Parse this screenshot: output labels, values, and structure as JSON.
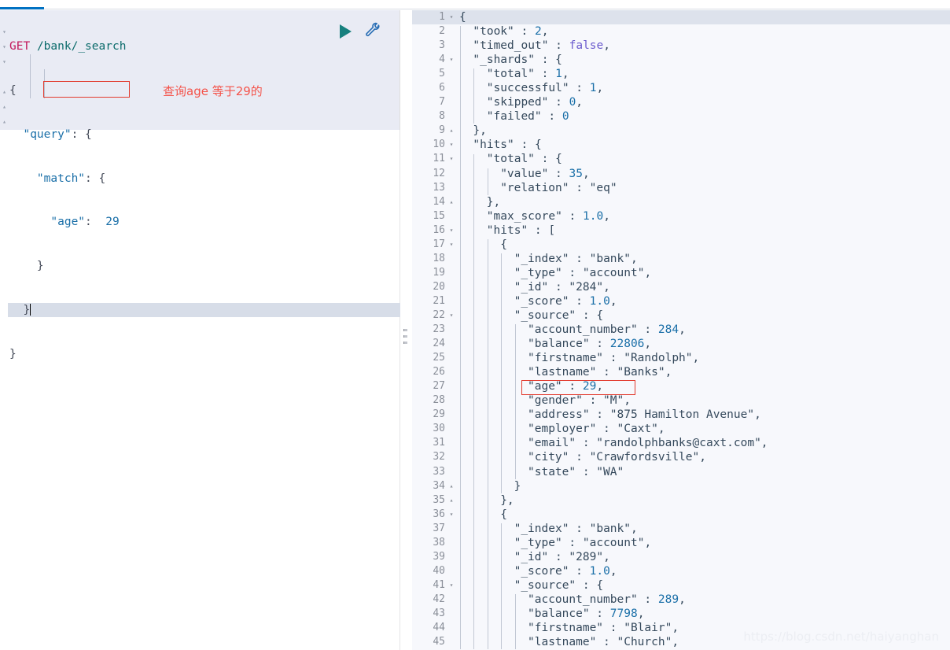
{
  "colors": {
    "accent": "#0071c2",
    "play": "#17807e",
    "wrench": "#2a6fb5",
    "annotation": "#f4534a",
    "redbox": "#e23b2e",
    "editor_bg": "#e9ebf4",
    "output_bg": "#f7f8fc",
    "active_line": "#d7dde8"
  },
  "toolbar": {
    "play_label": "play-icon",
    "wrench_label": "wrench-icon"
  },
  "request_editor": {
    "method": "GET",
    "path": "/bank/_search",
    "lines": [
      "GET /bank/_search",
      "{",
      "  \"query\": {",
      "    \"match\": {",
      "      \"age\": 29",
      "    }",
      "  }",
      "}"
    ],
    "tokens": {
      "l1_method": "GET",
      "l1_path": "/bank/_search",
      "l2": "{",
      "l3_key": "\"query\"",
      "l3_colon": ":",
      "l3_brace": "{",
      "l4_key": "\"match\"",
      "l4_colon": ":",
      "l4_brace": "{",
      "l5_key": "\"age\"",
      "l5_colon": ":",
      "l5_value": "29",
      "l6": "}",
      "l7": "}",
      "l8": "}"
    },
    "annotation": "查询age 等于29的",
    "highlight_field": "\"age\": 29"
  },
  "response": {
    "highlight_field": "\"age\" : 29,",
    "lines": [
      {
        "n": "1",
        "fold": "▾",
        "active": true,
        "indent": 0,
        "text": "{"
      },
      {
        "n": "2",
        "fold": "",
        "active": false,
        "indent": 1,
        "text": "\"took\" : 2,"
      },
      {
        "n": "3",
        "fold": "",
        "active": false,
        "indent": 1,
        "text": "\"timed_out\" : false,"
      },
      {
        "n": "4",
        "fold": "▾",
        "active": false,
        "indent": 1,
        "text": "\"_shards\" : {"
      },
      {
        "n": "5",
        "fold": "",
        "active": false,
        "indent": 2,
        "text": "\"total\" : 1,"
      },
      {
        "n": "6",
        "fold": "",
        "active": false,
        "indent": 2,
        "text": "\"successful\" : 1,"
      },
      {
        "n": "7",
        "fold": "",
        "active": false,
        "indent": 2,
        "text": "\"skipped\" : 0,"
      },
      {
        "n": "8",
        "fold": "",
        "active": false,
        "indent": 2,
        "text": "\"failed\" : 0"
      },
      {
        "n": "9",
        "fold": "▴",
        "active": false,
        "indent": 1,
        "text": "},"
      },
      {
        "n": "10",
        "fold": "▾",
        "active": false,
        "indent": 1,
        "text": "\"hits\" : {"
      },
      {
        "n": "11",
        "fold": "▾",
        "active": false,
        "indent": 2,
        "text": "\"total\" : {"
      },
      {
        "n": "12",
        "fold": "",
        "active": false,
        "indent": 3,
        "text": "\"value\" : 35,"
      },
      {
        "n": "13",
        "fold": "",
        "active": false,
        "indent": 3,
        "text": "\"relation\" : \"eq\""
      },
      {
        "n": "14",
        "fold": "▴",
        "active": false,
        "indent": 2,
        "text": "},"
      },
      {
        "n": "15",
        "fold": "",
        "active": false,
        "indent": 2,
        "text": "\"max_score\" : 1.0,"
      },
      {
        "n": "16",
        "fold": "▾",
        "active": false,
        "indent": 2,
        "text": "\"hits\" : ["
      },
      {
        "n": "17",
        "fold": "▾",
        "active": false,
        "indent": 3,
        "text": "{"
      },
      {
        "n": "18",
        "fold": "",
        "active": false,
        "indent": 4,
        "text": "\"_index\" : \"bank\","
      },
      {
        "n": "19",
        "fold": "",
        "active": false,
        "indent": 4,
        "text": "\"_type\" : \"account\","
      },
      {
        "n": "20",
        "fold": "",
        "active": false,
        "indent": 4,
        "text": "\"_id\" : \"284\","
      },
      {
        "n": "21",
        "fold": "",
        "active": false,
        "indent": 4,
        "text": "\"_score\" : 1.0,"
      },
      {
        "n": "22",
        "fold": "▾",
        "active": false,
        "indent": 4,
        "text": "\"_source\" : {"
      },
      {
        "n": "23",
        "fold": "",
        "active": false,
        "indent": 5,
        "text": "\"account_number\" : 284,"
      },
      {
        "n": "24",
        "fold": "",
        "active": false,
        "indent": 5,
        "text": "\"balance\" : 22806,"
      },
      {
        "n": "25",
        "fold": "",
        "active": false,
        "indent": 5,
        "text": "\"firstname\" : \"Randolph\","
      },
      {
        "n": "26",
        "fold": "",
        "active": false,
        "indent": 5,
        "text": "\"lastname\" : \"Banks\","
      },
      {
        "n": "27",
        "fold": "",
        "active": false,
        "indent": 5,
        "text": "\"age\" : 29,"
      },
      {
        "n": "28",
        "fold": "",
        "active": false,
        "indent": 5,
        "text": "\"gender\" : \"M\","
      },
      {
        "n": "29",
        "fold": "",
        "active": false,
        "indent": 5,
        "text": "\"address\" : \"875 Hamilton Avenue\","
      },
      {
        "n": "30",
        "fold": "",
        "active": false,
        "indent": 5,
        "text": "\"employer\" : \"Caxt\","
      },
      {
        "n": "31",
        "fold": "",
        "active": false,
        "indent": 5,
        "text": "\"email\" : \"randolphbanks@caxt.com\","
      },
      {
        "n": "32",
        "fold": "",
        "active": false,
        "indent": 5,
        "text": "\"city\" : \"Crawfordsville\","
      },
      {
        "n": "33",
        "fold": "",
        "active": false,
        "indent": 5,
        "text": "\"state\" : \"WA\""
      },
      {
        "n": "34",
        "fold": "▴",
        "active": false,
        "indent": 4,
        "text": "}"
      },
      {
        "n": "35",
        "fold": "▴",
        "active": false,
        "indent": 3,
        "text": "},"
      },
      {
        "n": "36",
        "fold": "▾",
        "active": false,
        "indent": 3,
        "text": "{"
      },
      {
        "n": "37",
        "fold": "",
        "active": false,
        "indent": 4,
        "text": "\"_index\" : \"bank\","
      },
      {
        "n": "38",
        "fold": "",
        "active": false,
        "indent": 4,
        "text": "\"_type\" : \"account\","
      },
      {
        "n": "39",
        "fold": "",
        "active": false,
        "indent": 4,
        "text": "\"_id\" : \"289\","
      },
      {
        "n": "40",
        "fold": "",
        "active": false,
        "indent": 4,
        "text": "\"_score\" : 1.0,"
      },
      {
        "n": "41",
        "fold": "▾",
        "active": false,
        "indent": 4,
        "text": "\"_source\" : {"
      },
      {
        "n": "42",
        "fold": "",
        "active": false,
        "indent": 5,
        "text": "\"account_number\" : 289,"
      },
      {
        "n": "43",
        "fold": "",
        "active": false,
        "indent": 5,
        "text": "\"balance\" : 7798,"
      },
      {
        "n": "44",
        "fold": "",
        "active": false,
        "indent": 5,
        "text": "\"firstname\" : \"Blair\","
      },
      {
        "n": "45",
        "fold": "",
        "active": false,
        "indent": 5,
        "text": "\"lastname\" : \"Church\","
      }
    ]
  },
  "watermark": "https://blog.csdn.net/haiyanghan"
}
